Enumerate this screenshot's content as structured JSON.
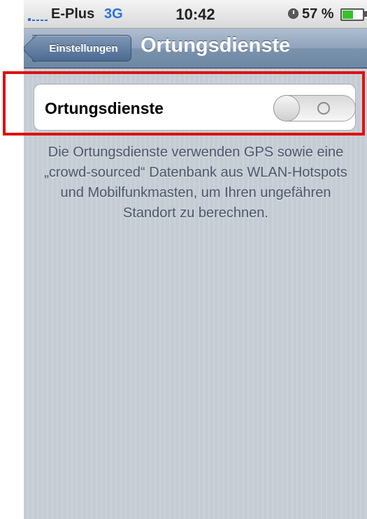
{
  "status_bar": {
    "carrier": "E-Plus",
    "network": "3G",
    "time": "10:42",
    "battery_percent": "57 %",
    "battery_level": 0.57,
    "icons": [
      "signal-icon",
      "alarm-icon",
      "battery-icon"
    ]
  },
  "nav": {
    "back_label": "Einstellungen",
    "title": "Ortungsdienste"
  },
  "setting": {
    "label": "Ortungsdienste",
    "toggle_state": "off",
    "toggle_glyph": "O"
  },
  "footer_text": "Die Ortungsdienste verwenden GPS sowie eine „crowd-sourced“ Datenbank aus WLAN-Hotspots und Mobilfunkmasten, um Ihren ungefähren Standort zu berechnen.",
  "colors": {
    "highlight": "#e01010",
    "network": "#2a74d8",
    "battery": "#37c22b",
    "nav_bar": "#6d87a4"
  }
}
